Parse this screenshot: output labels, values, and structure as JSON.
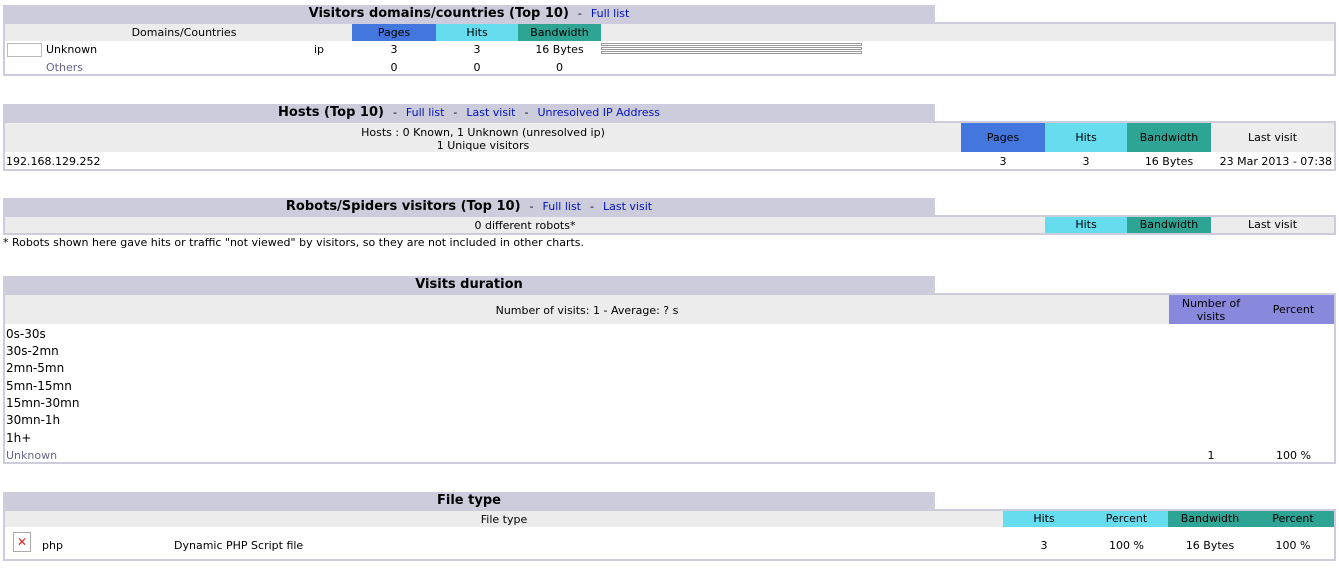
{
  "domains": {
    "title": "Visitors domains/countries (Top 10)",
    "full_list": "Full list",
    "col_domains": "Domains/Countries",
    "col_pages": "Pages",
    "col_hits": "Hits",
    "col_bandwidth": "Bandwidth",
    "rows": [
      {
        "name": "Unknown",
        "code": "ip",
        "pages": "3",
        "hits": "3",
        "bandwidth": "16 Bytes"
      }
    ],
    "others": {
      "name": "Others",
      "pages": "0",
      "hits": "0",
      "bandwidth": "0"
    }
  },
  "hosts": {
    "title": "Hosts (Top 10)",
    "full_list": "Full list",
    "last_visit_link": "Last visit",
    "unresolved_link": "Unresolved IP Address",
    "summary_line1": "Hosts : 0 Known, 1 Unknown (unresolved ip)",
    "summary_line2": "1 Unique visitors",
    "col_pages": "Pages",
    "col_hits": "Hits",
    "col_bandwidth": "Bandwidth",
    "col_last_visit": "Last visit",
    "rows": [
      {
        "host": "192.168.129.252",
        "pages": "3",
        "hits": "3",
        "bandwidth": "16 Bytes",
        "last_visit": "23 Mar 2013 - 07:38"
      }
    ]
  },
  "robots": {
    "title": "Robots/Spiders visitors (Top 10)",
    "full_list": "Full list",
    "last_visit_link": "Last visit",
    "summary": "0 different robots*",
    "col_hits": "Hits",
    "col_bandwidth": "Bandwidth",
    "col_last_visit": "Last visit",
    "footnote": "* Robots shown here gave hits or traffic \"not viewed\" by visitors, so they are not included in other charts."
  },
  "duration": {
    "title": "Visits duration",
    "summary": "Number of visits: 1 - Average: ? s",
    "col_visits": "Number of visits",
    "col_percent": "Percent",
    "ranges": [
      "0s-30s",
      "30s-2mn",
      "2mn-5mn",
      "5mn-15mn",
      "15mn-30mn",
      "30mn-1h",
      "1h+"
    ],
    "unknown": {
      "label": "Unknown",
      "visits": "1",
      "percent": "100 %"
    }
  },
  "filetype": {
    "title": "File type",
    "col_filetype": "File type",
    "col_hits": "Hits",
    "col_percent": "Percent",
    "col_bandwidth": "Bandwidth",
    "col_percent2": "Percent",
    "rows": [
      {
        "ext": "php",
        "desc": "Dynamic PHP Script file",
        "hits": "3",
        "percent": "100 %",
        "bandwidth": "16 Bytes",
        "bw_percent": "100 %",
        "icon": "broken-image-icon"
      }
    ]
  },
  "colors": {
    "section_header": "#ccccdd",
    "pages": "#4477dd",
    "hits": "#66ddee",
    "bandwidth": "#2ea495",
    "percent": "#8888dd",
    "link": "#0011bb"
  }
}
